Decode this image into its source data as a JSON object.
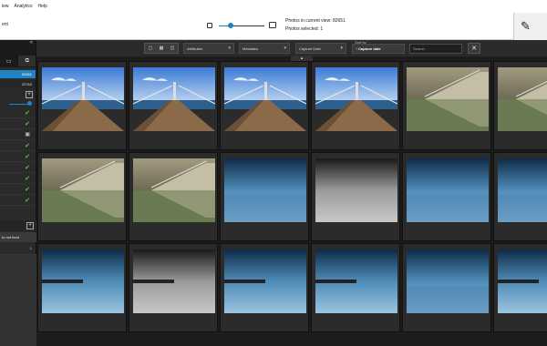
{
  "menu": {
    "items": [
      "iew",
      "Analytics",
      "Help"
    ]
  },
  "topbar": {
    "subtitle": "ent",
    "viewinfo": {
      "current": "Photos in current view: 82651",
      "selected": "Photos selected: 1"
    },
    "zoom_fraction": 0.25
  },
  "sidebar": {
    "counts": {
      "selected": "82651",
      "second": "20763"
    },
    "not_found_label": "to not fond",
    "not_found_count": "1"
  },
  "filters": {
    "attributes": "Attributes",
    "metadata": "Metadata",
    "capture_date": "Capture Date",
    "sort_label": "Sort by",
    "sort_value": "↑ Capture date",
    "search_placeholder": "Search",
    "clear_symbol": "✕"
  },
  "thumbnails": [
    {
      "type": "pier"
    },
    {
      "type": "pier"
    },
    {
      "type": "pier"
    },
    {
      "type": "pier2"
    },
    {
      "type": "stairs"
    },
    {
      "type": "stairs"
    },
    {
      "type": "stairs"
    },
    {
      "type": "stairs"
    },
    {
      "type": "sea"
    },
    {
      "type": "sea_bw"
    },
    {
      "type": "sea"
    },
    {
      "type": "sea"
    },
    {
      "type": "jetty"
    },
    {
      "type": "jetty_bw"
    },
    {
      "type": "jetty"
    },
    {
      "type": "jetty"
    },
    {
      "type": "sea"
    },
    {
      "type": "jetty"
    }
  ],
  "colors": {
    "accent": "#1f84c6",
    "check": "#59c04a"
  }
}
